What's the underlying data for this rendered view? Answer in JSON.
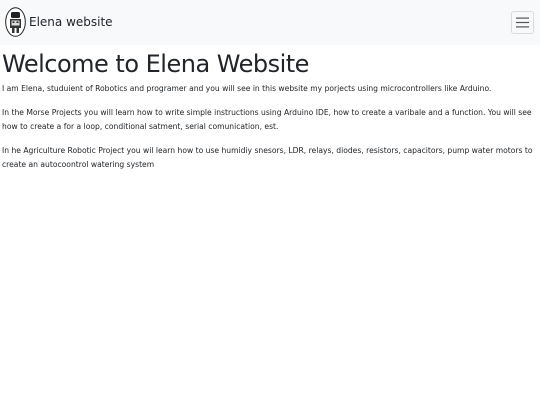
{
  "navbar": {
    "brand_label": "Elena website",
    "logo_icon": "robot-logo-icon",
    "menu_icon": "hamburger-menu-icon",
    "background": "#f8f9fa"
  },
  "main": {
    "title": "Welcome to Elena Website",
    "paragraphs": [
      "I am Elena, studuient of Robotics and programer and you will see in this website my porjects using microcontrollers like Arduino.",
      "In the Morse Projects you will learn how to write simple instructions using Arduino IDE, how to create a varibale and a function. You will see how to create a for a loop, conditional satment, serial comunication, est.",
      "In he Agriculture Robotic Project you wil learn how to use humidiy snesors, LDR, relays, diodes, resistors, capacitors, pump water motors to create an autocoontrol watering system"
    ]
  }
}
